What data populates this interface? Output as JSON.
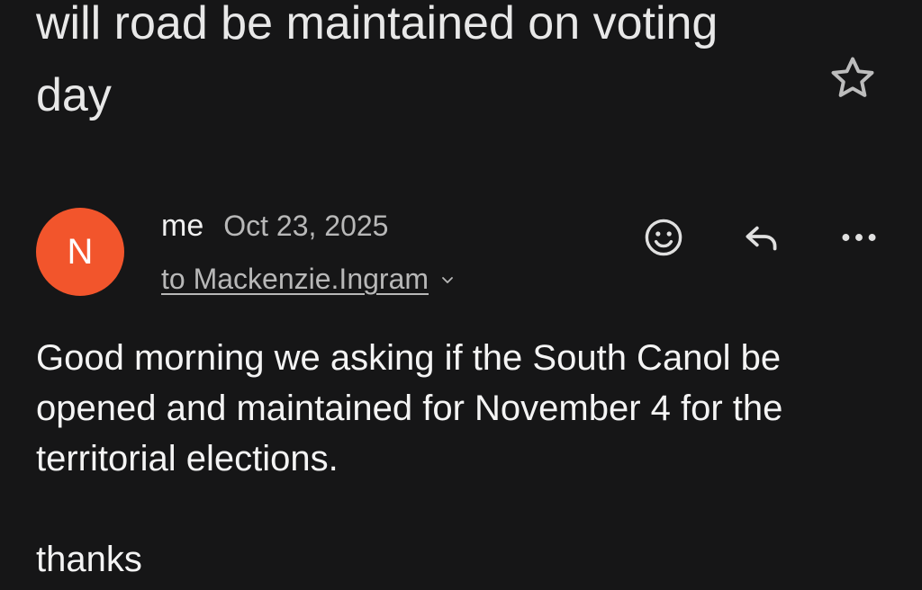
{
  "email": {
    "subject": "will road be maintained on voting day",
    "sender": {
      "avatar_initial": "N",
      "avatar_color": "#f2552c",
      "name": "me",
      "date": "Oct 23, 2025",
      "recipients": "to Mackenzie.Ingram"
    },
    "body": {
      "paragraph": "Good morning we asking if the South Canol be opened and maintained for November 4 for the territorial elections.",
      "signoff": "thanks"
    }
  },
  "icons": {
    "star": "star-icon",
    "emoji": "emoji-icon",
    "reply": "reply-icon",
    "more": "more-horizontal-icon",
    "expand": "chevron-down-icon"
  }
}
